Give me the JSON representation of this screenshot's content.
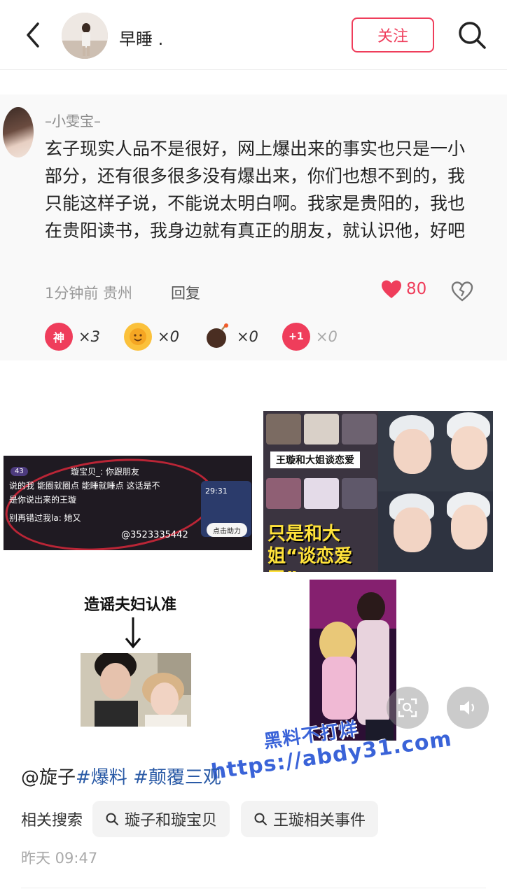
{
  "header": {
    "username": "早睡 .",
    "follow_label": "关注"
  },
  "comment": {
    "author": "–小雯宝–",
    "text": "玄子现实人品不是很好，网上爆出来的事实也只是一小部分，还有很多很多没有爆出来，你们也想不到的，我只能这样子说，不能说太明白啊。我家是贵阳的，我也在贵阳读书，我身边就有真正的朋友，就认识他，好吧",
    "meta": "1分钟前 贵州",
    "reply_label": "回复",
    "like_count": "80",
    "reactions": [
      {
        "icon": "shen-badge-icon",
        "glyph": "神",
        "count": "×3",
        "color": "#ef3d5b"
      },
      {
        "icon": "sun-face-icon",
        "glyph": "😊",
        "count": "×0",
        "color": "#f5a623"
      },
      {
        "icon": "bomb-icon",
        "glyph": "●",
        "count": "×0",
        "color": "#5a3a2a"
      },
      {
        "icon": "plus-one-icon",
        "glyph": "+1",
        "count": "×0",
        "color": "#ef3d5b"
      }
    ]
  },
  "collage": {
    "shot1_lines": [
      "璇宝贝_: 你跟朋友",
      "说的我 能圈就圈点 能睡就睡点 这话是不",
      "是你说出来的王璇",
      "别再错过我la: 她又",
      "@3523335442"
    ],
    "shot1_badge": "43",
    "shot1_button": "点击助力",
    "shot1_timer": "29:31",
    "grid_banner_1": "王璇和大姐谈恋爱",
    "grid_banner_2": "只是和大姐“谈恋爱了”",
    "arrow_caption": "造谣夫妇认准"
  },
  "watermark": {
    "line1": "黑料不打烊",
    "line2": "https://abdy31.com"
  },
  "post": {
    "mention": "@旋子",
    "tags": [
      "#爆料",
      "#颠覆三观"
    ],
    "related_label": "相关搜索",
    "related_chips": [
      "璇子和璇宝贝",
      "王璇相关事件"
    ],
    "timestamp": "昨天 09:47"
  },
  "colors": {
    "accent": "#ef3d5b",
    "tag_blue": "#2a5aa6",
    "watermark_blue": "#3a63d8"
  }
}
